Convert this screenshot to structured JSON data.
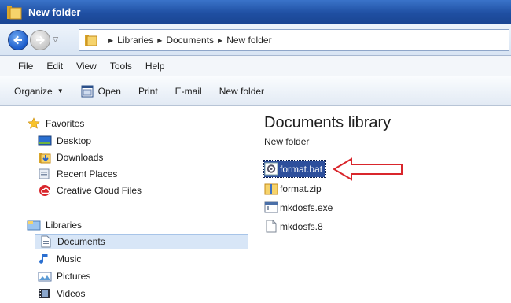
{
  "window": {
    "title": "New folder"
  },
  "address": {
    "breadcrumb": [
      "Libraries",
      "Documents",
      "New folder"
    ]
  },
  "menu": {
    "items": [
      "File",
      "Edit",
      "View",
      "Tools",
      "Help"
    ]
  },
  "commands": {
    "organize": "Organize",
    "open": "Open",
    "print": "Print",
    "email": "E-mail",
    "new_folder": "New folder"
  },
  "nav": {
    "favorites": "Favorites",
    "desktop": "Desktop",
    "downloads": "Downloads",
    "recent": "Recent Places",
    "creative_cloud": "Creative Cloud Files",
    "libraries": "Libraries",
    "documents": "Documents",
    "music": "Music",
    "pictures": "Pictures",
    "videos": "Videos"
  },
  "content": {
    "title": "Documents library",
    "subtitle": "New folder",
    "files": [
      "format.bat",
      "format.zip",
      "mkdosfs.exe",
      "mkdosfs.8"
    ]
  },
  "colors": {
    "selection": "#2d4f9c",
    "arrow": "#d9262c",
    "titlebar": "#1f4fa2"
  }
}
